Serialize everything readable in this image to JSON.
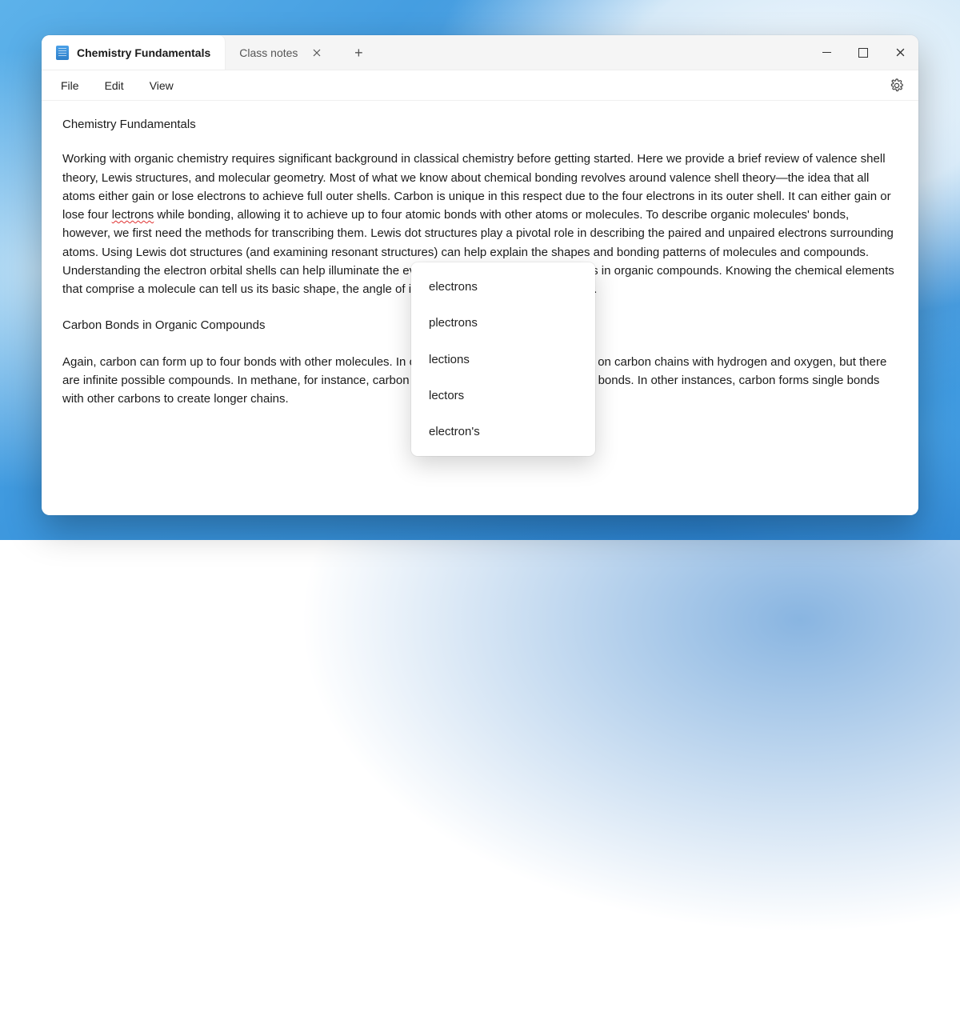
{
  "tabs": {
    "active": {
      "label": "Chemistry Fundamentals"
    },
    "inactive": {
      "label": "Class notes"
    }
  },
  "menu": {
    "file": "File",
    "edit": "Edit",
    "view": "View"
  },
  "document": {
    "title": "Chemistry Fundamentals",
    "p1_a": "Working with organic chemistry requires significant background in classical chemistry before getting started. Here we provide a brief review of valence shell theory, Lewis structures, and molecular geometry. Most of what we know about chemical bonding revolves around valence shell theory—the idea that all atoms either gain or lose electrons to achieve full outer shells. Carbon is unique in this respect due to the four electrons in its outer shell. It can either gain or lose four ",
    "misspelled": "lectrons",
    "p1_b": " while bonding, allowing it to achieve up to four atomic bonds with other atoms or molecules. To describe organic molecules' bonds, however, we first need the methods for transcribing them. Lewis dot structures play a pivotal role in describing the paired and unpaired electrons surrounding atoms. Using Lewis dot structures (and examining resonant structures) can help explain the shapes and bonding patterns of molecules and compounds. Understanding the electron orbital shells can help illuminate the eventual shapes and resulting bonds in organic compounds. Knowing the chemical elements that comprise a molecule can tell us its basic shape, the angle of its bonds, and its ultimate reactivity.",
    "subheading": "Carbon Bonds in Organic Compounds",
    "p2": "Again, carbon can form up to four bonds with other molecules. In organic chemistry, we mainly focus on carbon chains with hydrogen and oxygen, but there are infinite possible compounds. In methane, for instance, carbon bonds with four hydrogen in single bonds. In other instances, carbon forms single bonds with other carbons to create longer chains."
  },
  "suggestions": [
    "electrons",
    "plectrons",
    "lections",
    "lectors",
    "electron's"
  ]
}
